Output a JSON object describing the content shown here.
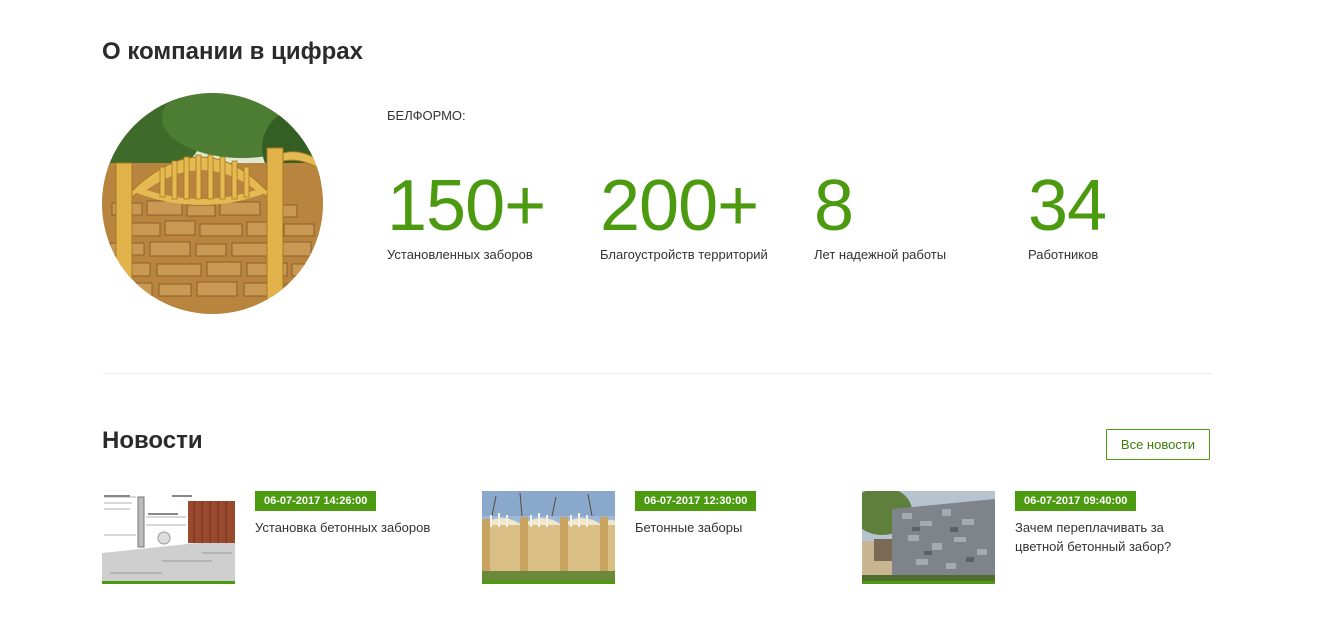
{
  "about": {
    "title": "О компании в цифрах",
    "company_label": "БЕЛФОРМО:",
    "stats": [
      {
        "value": "150+",
        "label": "Установленных заборов"
      },
      {
        "value": "200+",
        "label": "Благоустройств территорий"
      },
      {
        "value": "8",
        "label": "Лет надежной работы"
      },
      {
        "value": "34",
        "label": "Работников"
      }
    ]
  },
  "news": {
    "title": "Новости",
    "all_news_label": "Все новости",
    "items": [
      {
        "date": "06-07-2017 14:26:00",
        "title": "Установка бетонных заборов"
      },
      {
        "date": "06-07-2017 12:30:00",
        "title": "Бетонные заборы"
      },
      {
        "date": "06-07-2017 09:40:00",
        "title": "Зачем переплачивать за цветной бетонный забор?"
      }
    ]
  },
  "colors": {
    "accent": "#4c9a10",
    "text": "#333333"
  }
}
